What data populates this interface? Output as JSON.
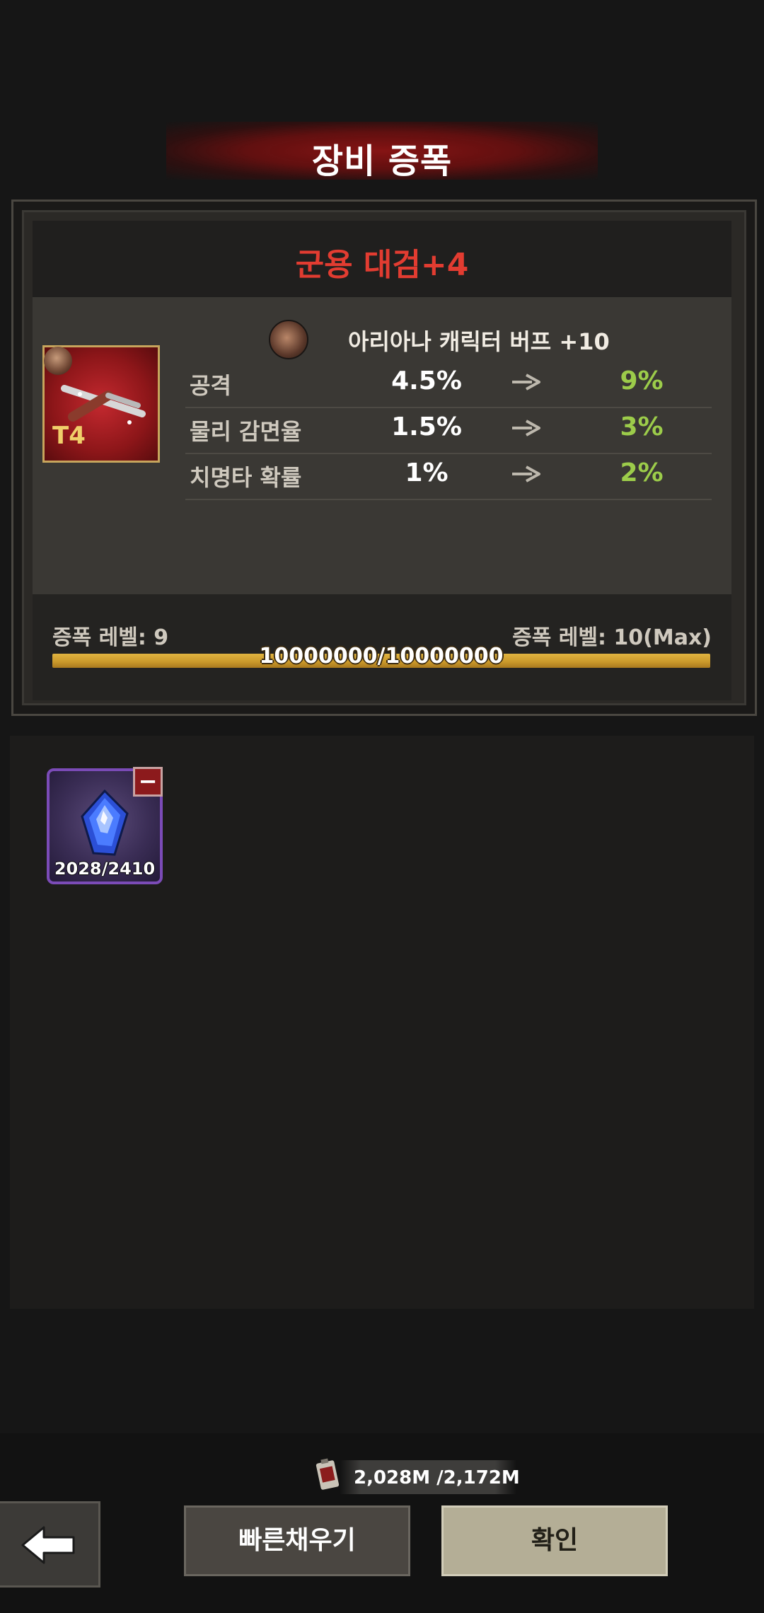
{
  "header": {
    "title": "장비 증폭"
  },
  "equipment": {
    "name": "군용 대검+4",
    "tier": "T4",
    "icon": "crossbow-icon"
  },
  "buff": {
    "avatar_icon": "character-portrait-icon",
    "text": "아리아나 캐릭터 버프 +10"
  },
  "stats": [
    {
      "label": "공격",
      "from": "4.5%",
      "to": "9%"
    },
    {
      "label": "물리 감면율",
      "from": "1.5%",
      "to": "3%"
    },
    {
      "label": "치명타 확률",
      "from": "1%",
      "to": "2%"
    }
  ],
  "level": {
    "current": "증폭 레벨: 9",
    "max": "증폭 레벨: 10(Max)",
    "progress_text": "10000000/10000000",
    "progress_fraction": 1.0
  },
  "materials": [
    {
      "icon": "blue-crystal-icon",
      "count": "2028/2410",
      "remove_label": "−"
    }
  ],
  "currency": {
    "icon": "fuel-can-icon",
    "text": "2,028M /2,172M"
  },
  "buttons": {
    "back_icon": "back-arrow-icon",
    "quick_fill": "빠른채우기",
    "confirm": "확인"
  },
  "colors": {
    "item_name": "#e23c31",
    "stat_to": "#9ccc4a",
    "progress": "#c9982a",
    "material_border": "#7b4bb7"
  }
}
